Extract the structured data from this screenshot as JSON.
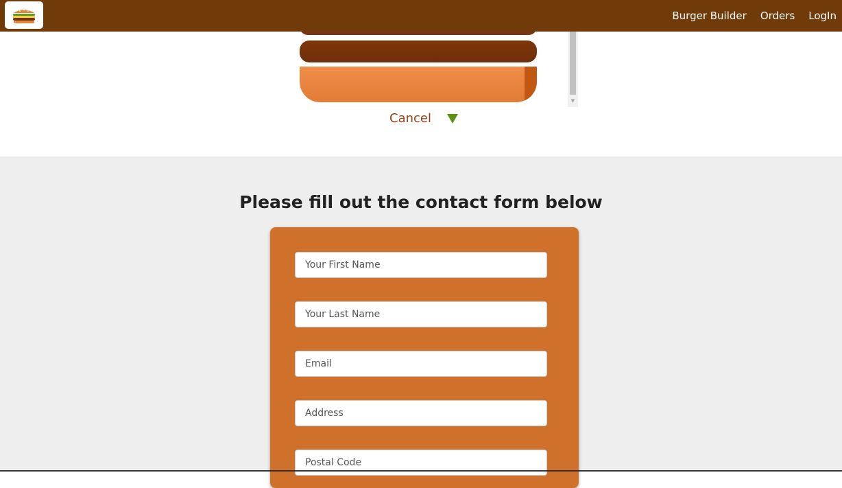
{
  "header": {
    "logo_icon": "burger-logo-icon",
    "nav": [
      {
        "label": "Burger Builder"
      },
      {
        "label": "Orders"
      },
      {
        "label": "LogIn"
      }
    ]
  },
  "modal": {
    "cancel_label": "Cancel",
    "continue_icon": "triangle-down-icon"
  },
  "form": {
    "title": "Please fill out the contact form below",
    "fields": [
      {
        "placeholder": "Your First Name",
        "value": ""
      },
      {
        "placeholder": "Your Last Name",
        "value": ""
      },
      {
        "placeholder": "Email",
        "value": ""
      },
      {
        "placeholder": "Address",
        "value": ""
      },
      {
        "placeholder": "Postal Code",
        "value": ""
      }
    ]
  },
  "colors": {
    "toolbar": "#703b09",
    "card": "#cf712b",
    "meat": "#7f3608",
    "bun": "#f08e4a",
    "cancel_text": "#944317",
    "continue_arrow": "#5c9210",
    "form_background": "#eeeeee"
  }
}
